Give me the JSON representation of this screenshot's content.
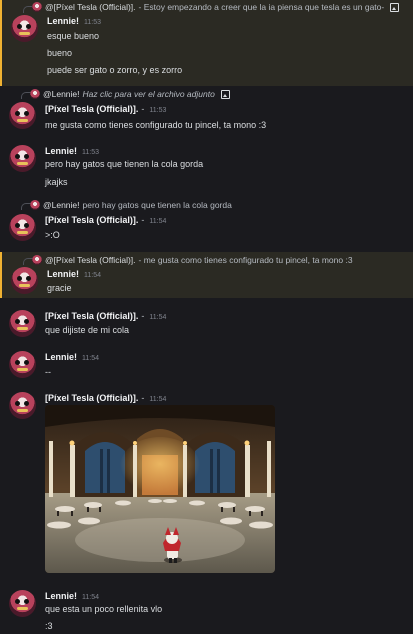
{
  "messages": [
    {
      "reply": {
        "mention": "@[Píxel Tesla (Official)].",
        "text": "- Estoy empezando a creer que la ia piensa que tesla es un gato-"
      },
      "author": "Lennie!",
      "time": "11:53",
      "lines": [
        "esque bueno",
        "bueno",
        "puede ser gato o zorro, y es zorro"
      ]
    },
    {
      "reply": {
        "mention": "@Lennie!",
        "text": "Haz clic para ver el archivo adjunto"
      },
      "author": "[Píxel Tesla (Official)].",
      "tag": "-",
      "time": "11:53",
      "lines": [
        "me gusta como tienes configurado tu pincel, ta mono :3"
      ]
    },
    {
      "author": "Lennie!",
      "time": "11:53",
      "lines": [
        "pero hay gatos que tienen la cola gorda",
        "jkajks"
      ]
    },
    {
      "reply": {
        "mention": "@Lennie!",
        "text": "pero hay gatos que tienen la cola gorda"
      },
      "author": "[Píxel Tesla (Official)].",
      "tag": "-",
      "time": "11:54",
      "lines": [
        ">:O"
      ]
    },
    {
      "reply": {
        "mention": "@[Píxel Tesla (Official)].",
        "text": "- me gusta como tienes configurado tu pincel, ta mono :3"
      },
      "author": "Lennie!",
      "time": "11:54",
      "lines": [
        "gracie"
      ]
    },
    {
      "author": "[Píxel Tesla (Official)].",
      "tag": "-",
      "time": "11:54",
      "lines": [
        "que dijiste de mi cola"
      ]
    },
    {
      "author": "Lennie!",
      "time": "11:54",
      "lines": [
        "--"
      ]
    },
    {
      "author": "[Píxel Tesla (Official)].",
      "tag": "-",
      "time": "11:54",
      "lines": []
    },
    {
      "author": "Lennie!",
      "time": "11:54",
      "lines": [
        "que esta un poco rellenita vlo",
        ":3"
      ]
    }
  ],
  "colors": {
    "background": "#1a1a1e",
    "highlight_background": "#2b2a23",
    "highlight_bar": "#f0b232",
    "username": "#f2f3f5",
    "timestamp": "#80848e"
  }
}
